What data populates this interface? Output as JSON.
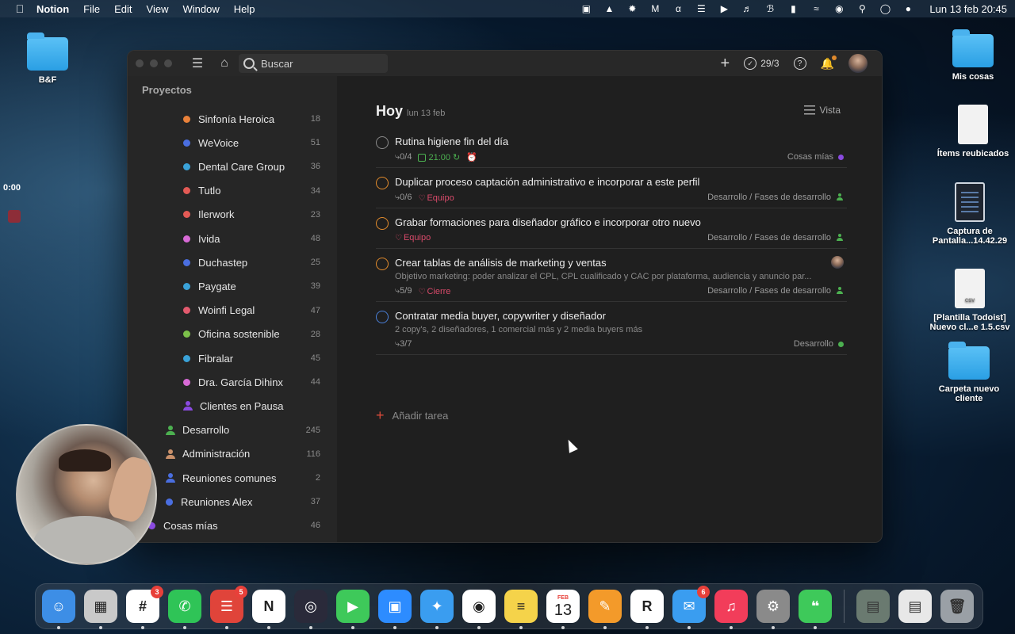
{
  "menubar": {
    "app_name": "Notion",
    "items": [
      "File",
      "Edit",
      "View",
      "Window",
      "Help"
    ],
    "clock": "Lun 13 feb  20:45"
  },
  "desktop": {
    "icons": [
      {
        "label": "B&F",
        "type": "folder"
      },
      {
        "label": "Mis cosas",
        "type": "folder"
      },
      {
        "label": "Ítems reubicados",
        "type": "doc"
      },
      {
        "label": "Captura de Pantalla...14.42.29",
        "type": "screenshot"
      },
      {
        "label": "[Plantilla Todoist] Nuevo cl...e 1.5.csv",
        "type": "csv"
      },
      {
        "label": "Carpeta nuevo cliente",
        "type": "folder"
      }
    ],
    "timer": "0:00",
    "csv_tag": "CSV"
  },
  "app": {
    "search_placeholder": "Buscar",
    "karma": "29/3",
    "sidebar": {
      "header": "Proyectos",
      "items": [
        {
          "name": "Sinfonía Heroica",
          "count": "18",
          "color": "#e9813a",
          "icon": "dot",
          "indent": 1
        },
        {
          "name": "WeVoice",
          "count": "51",
          "color": "#4a6ee0",
          "icon": "dot",
          "indent": 1
        },
        {
          "name": "Dental Care Group",
          "count": "36",
          "color": "#3aa2d8",
          "icon": "dot",
          "indent": 1
        },
        {
          "name": "Tutlo",
          "count": "34",
          "color": "#e35a55",
          "icon": "dot",
          "indent": 1
        },
        {
          "name": "Ilerwork",
          "count": "23",
          "color": "#e35a55",
          "icon": "dot",
          "indent": 1
        },
        {
          "name": "Ivida",
          "count": "48",
          "color": "#d86ad6",
          "icon": "dot",
          "indent": 1
        },
        {
          "name": "Duchastep",
          "count": "25",
          "color": "#4a6ee0",
          "icon": "dot",
          "indent": 1
        },
        {
          "name": "Paygate",
          "count": "39",
          "color": "#3aa2d8",
          "icon": "dot",
          "indent": 1
        },
        {
          "name": "Woinfi Legal",
          "count": "47",
          "color": "#e35a6e",
          "icon": "dot",
          "indent": 1
        },
        {
          "name": "Oficina sostenible",
          "count": "28",
          "color": "#7cc04a",
          "icon": "dot",
          "indent": 1
        },
        {
          "name": "Fibralar",
          "count": "45",
          "color": "#3aa2d8",
          "icon": "dot",
          "indent": 1
        },
        {
          "name": "Dra. García Dihinx",
          "count": "44",
          "color": "#d86ad6",
          "icon": "dot",
          "indent": 1
        },
        {
          "name": "Clientes en Pausa",
          "count": "",
          "color": "#8a4ae0",
          "icon": "person",
          "indent": 1
        },
        {
          "name": "Desarrollo",
          "count": "245",
          "color": "#4cb050",
          "icon": "person",
          "indent": 0
        },
        {
          "name": "Administración",
          "count": "116",
          "color": "#c9906a",
          "icon": "person",
          "indent": 0
        },
        {
          "name": "Reuniones comunes",
          "count": "2",
          "color": "#4a6ee0",
          "icon": "person",
          "indent": 0
        },
        {
          "name": "Reuniones Alex",
          "count": "37",
          "color": "#4a6ee0",
          "icon": "dot",
          "indent": 0
        },
        {
          "name": "Cosas mías",
          "count": "46",
          "color": "#8a4ae0",
          "icon": "dot",
          "indent": -1
        }
      ]
    },
    "main": {
      "title": "Hoy",
      "date": "lun 13 feb",
      "view_label": "Vista",
      "add_task_label": "Añadir tarea",
      "tasks": [
        {
          "title": "Rutina higiene fin del día",
          "subtasks": "0/4",
          "time": "21:00",
          "label": "",
          "desc": "",
          "project": "Cosas mías",
          "project_color": "#8a4ae0",
          "priority": "p4"
        },
        {
          "title": "Duplicar proceso captación administrativo e incorporar a este perfil",
          "subtasks": "0/6",
          "time": "",
          "label": "Equipo",
          "desc": "",
          "project": "Desarrollo / Fases de desarrollo",
          "project_color": "#4cb050",
          "priority": "p2"
        },
        {
          "title": "Grabar formaciones para diseñador gráfico e incorporar otro nuevo",
          "subtasks": "",
          "time": "",
          "label": "Equipo",
          "desc": "",
          "project": "Desarrollo / Fases de desarrollo",
          "project_color": "#4cb050",
          "priority": "p2"
        },
        {
          "title": "Crear tablas de análisis de marketing y ventas",
          "subtasks": "5/9",
          "time": "",
          "label": "Cierre",
          "desc": "Objetivo marketing: poder analizar el CPL, CPL cualificado y CAC por plataforma, audiencia y anuncio par...",
          "project": "Desarrollo / Fases de desarrollo",
          "project_color": "#4cb050",
          "priority": "p2"
        },
        {
          "title": "Contratar media buyer, copywriter y diseñador",
          "subtasks": "3/7",
          "time": "",
          "label": "",
          "desc": "2 copy's, 2 diseñadores, 1 comercial más y 2 media buyers más",
          "project": "Desarrollo",
          "project_color": "#4cb050",
          "priority": "p3"
        }
      ]
    }
  },
  "dock": {
    "apps": [
      {
        "name": "Finder",
        "icon": "finder-icon",
        "color": "#3d8ee6",
        "badge": ""
      },
      {
        "name": "Launchpad",
        "icon": "launchpad-icon",
        "color": "#c9c9c9",
        "badge": ""
      },
      {
        "name": "Slack",
        "icon": "slack-icon",
        "color": "#ffffff",
        "badge": "3"
      },
      {
        "name": "WhatsApp",
        "icon": "whatsapp-icon",
        "color": "#2fc457",
        "badge": ""
      },
      {
        "name": "Todoist",
        "icon": "todoist-icon",
        "color": "#e0443a",
        "badge": "5"
      },
      {
        "name": "Notion",
        "icon": "notion-icon",
        "color": "#ffffff",
        "badge": ""
      },
      {
        "name": "OBS",
        "icon": "obs-icon",
        "color": "#2a2a3a",
        "badge": ""
      },
      {
        "name": "FaceTime",
        "icon": "facetime-icon",
        "color": "#3ec95a",
        "badge": ""
      },
      {
        "name": "Zoom",
        "icon": "zoom-icon",
        "color": "#2d8cff",
        "badge": ""
      },
      {
        "name": "Safari",
        "icon": "safari-icon",
        "color": "#3a9df0",
        "badge": ""
      },
      {
        "name": "Chrome",
        "icon": "chrome-icon",
        "color": "#ffffff",
        "badge": ""
      },
      {
        "name": "Notes",
        "icon": "notes-icon",
        "color": "#f5d34a",
        "badge": ""
      },
      {
        "name": "Calendar",
        "icon": "calendar-icon",
        "color": "#ffffff",
        "badge": "",
        "month": "FEB",
        "day": "13"
      },
      {
        "name": "Pages",
        "icon": "pages-icon",
        "color": "#f39a2a",
        "badge": ""
      },
      {
        "name": "Reeder",
        "icon": "reeder-icon",
        "color": "#ffffff",
        "badge": ""
      },
      {
        "name": "Mail",
        "icon": "mail-icon",
        "color": "#3a9df0",
        "badge": "6"
      },
      {
        "name": "Music",
        "icon": "music-icon",
        "color": "#f23d5a",
        "badge": ""
      },
      {
        "name": "System Settings",
        "icon": "settings-icon",
        "color": "#8a8a8a",
        "badge": ""
      },
      {
        "name": "Messages",
        "icon": "messages-icon",
        "color": "#3ec95a",
        "badge": ""
      }
    ]
  }
}
